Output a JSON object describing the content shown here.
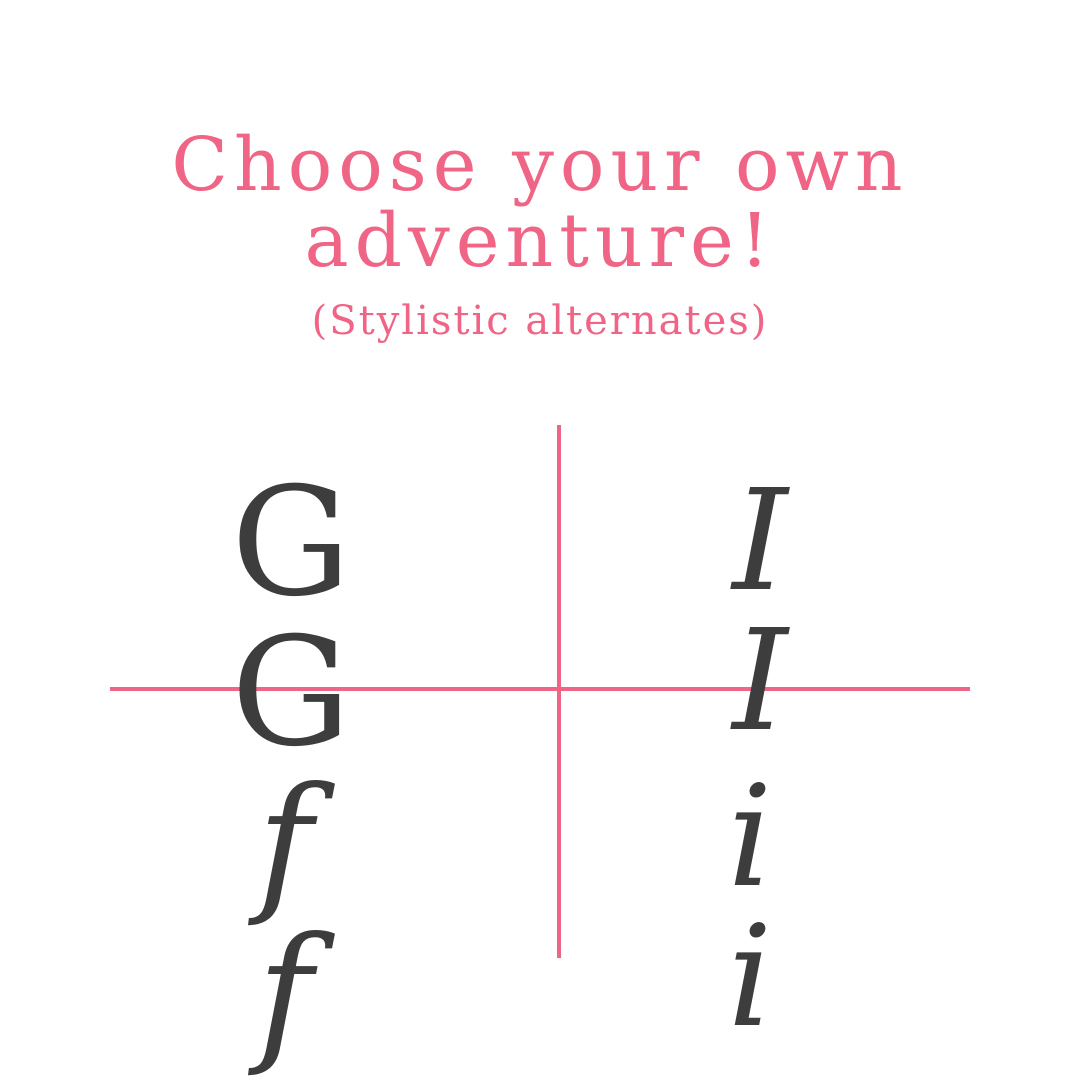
{
  "title": {
    "line1": "Choose your own",
    "line2": "adventure!",
    "subtitle": "(Stylistic alternates)"
  },
  "glyph_grid": {
    "top_left": "G G",
    "top_right": "I I",
    "bottom_left": "f f",
    "bottom_right": "i i"
  },
  "colors": {
    "accent": "#f06586",
    "glyph": "#3d3d3d",
    "background": "#ffffff"
  }
}
